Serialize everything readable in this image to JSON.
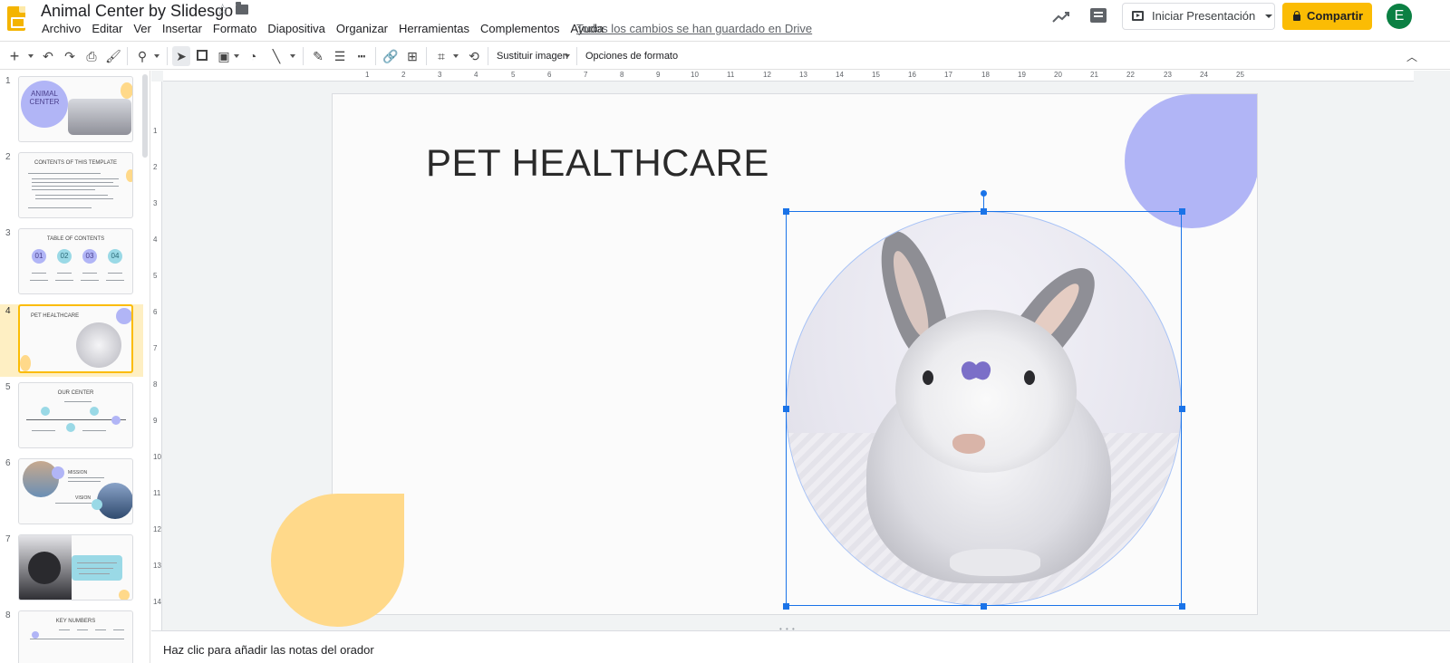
{
  "app": {
    "doc_title": "Animal Center by Slidesgo",
    "menus": [
      "Archivo",
      "Editar",
      "Ver",
      "Insertar",
      "Formato",
      "Diapositiva",
      "Organizar",
      "Herramientas",
      "Complementos",
      "Ayuda"
    ],
    "saved_status": "Todos los cambios se han guardado en Drive",
    "present_label": "Iniciar Presentación",
    "share_label": "Compartir",
    "avatar_initial": "E",
    "accent_color": "#fbbc04"
  },
  "toolbar": {
    "replace_image_label": "Sustituir imagen",
    "format_options_label": "Opciones de formato",
    "icons": [
      "add-icon",
      "undo-icon",
      "redo-icon",
      "print-icon",
      "paint-format-icon",
      "zoom-icon",
      "select-icon",
      "text-box-icon",
      "image-icon",
      "shape-icon",
      "line-icon",
      "pen-icon",
      "line-weight-icon",
      "line-dash-icon",
      "link-icon",
      "comment-add-icon",
      "crop-icon",
      "reset-image-icon"
    ]
  },
  "filmstrip": {
    "slides": [
      {
        "num": "1",
        "title": "ANIMAL CENTER"
      },
      {
        "num": "2",
        "title": "CONTENTS OF THIS TEMPLATE"
      },
      {
        "num": "3",
        "title": "TABLE OF CONTENTS",
        "items": [
          "01",
          "02",
          "03",
          "04"
        ]
      },
      {
        "num": "4",
        "title": "PET HEALTHCARE",
        "selected": true
      },
      {
        "num": "5",
        "title": "OUR CENTER"
      },
      {
        "num": "6",
        "title": "MISSION",
        "subtitle": "VISION"
      },
      {
        "num": "7",
        "title": ""
      },
      {
        "num": "8",
        "title": "KEY NUMBERS"
      }
    ]
  },
  "ruler": {
    "horizontal": [
      "1",
      "2",
      "3",
      "4",
      "5",
      "6",
      "7",
      "8",
      "9",
      "10",
      "11",
      "12",
      "13",
      "14",
      "15",
      "16",
      "17",
      "18",
      "19",
      "20",
      "21",
      "22",
      "23",
      "24",
      "25"
    ],
    "vertical": [
      "1",
      "2",
      "3",
      "4",
      "5",
      "6",
      "7",
      "8",
      "9",
      "10",
      "11",
      "12",
      "13",
      "14"
    ]
  },
  "slide": {
    "title": "PET HEALTHCARE",
    "image_subject": "rabbit",
    "deco_colors": {
      "purple": "#b1b5f6",
      "yellow": "#ffd98a"
    }
  },
  "notes": {
    "placeholder": "Haz clic para añadir las notas del orador"
  }
}
